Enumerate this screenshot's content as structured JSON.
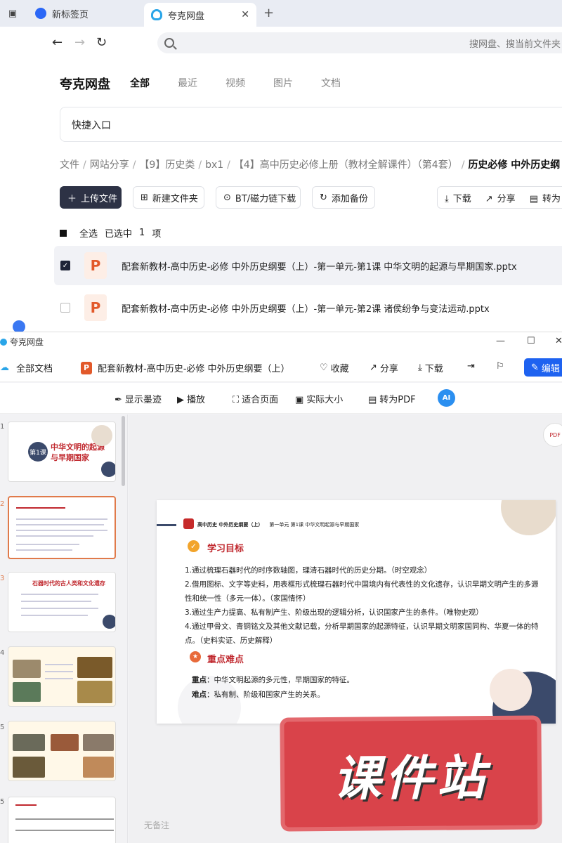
{
  "browser": {
    "tabs": [
      {
        "label": "新标签页"
      },
      {
        "label": "夸克网盘"
      }
    ],
    "address_placeholder": "搜网盘、搜当前文件夹"
  },
  "cloud": {
    "brand": "夸克网盘",
    "categories": [
      "全部",
      "最近",
      "视频",
      "图片",
      "文档"
    ],
    "quick_entry": "快捷入口",
    "breadcrumb": [
      "文件",
      "网站分享",
      "【9】历史类",
      "bx1",
      "【4】高中历史必修上册（教材全解课件）（第4套）",
      "历史必修 中外历史纲"
    ],
    "actions": {
      "upload": "上传文件",
      "new_folder": "新建文件夹",
      "bt": "BT/磁力链下载",
      "backup": "添加备份",
      "download": "下载",
      "share": "分享",
      "convert": "转为"
    },
    "selection": {
      "select_all": "全选",
      "selected": "已选中",
      "count": "1",
      "unit": "项"
    },
    "files": [
      {
        "name": "配套新教材-高中历史-必修  中外历史纲要（上）-第一单元-第1课  中华文明的起源与早期国家.pptx",
        "checked": true
      },
      {
        "name": "配套新教材-高中历史-必修  中外历史纲要（上）-第一单元-第2课  诸侯纷争与变法运动.pptx",
        "checked": false
      }
    ]
  },
  "viewer": {
    "window_title": "夸克网盘",
    "header": {
      "all_docs": "全部文档",
      "doc_title": "配套新教材-高中历史-必修 中外历史纲要（上）",
      "favorite": "收藏",
      "share": "分享",
      "download": "下载",
      "edit": "编辑"
    },
    "tools": {
      "show_ink": "显示墨迹",
      "play": "播放",
      "fit_page": "适合页面",
      "actual_size": "实际大小",
      "to_pdf": "转为PDF",
      "ai": "AI"
    },
    "thumbs": {
      "numbers": [
        "1",
        "2",
        "3",
        "4",
        "5",
        "5"
      ],
      "slide1_badge": "第1课",
      "slide1_title_1": "中华文明的起源",
      "slide1_title_2": "与早期国家",
      "slide3_title": "石器时代的古人类和文化遗存"
    },
    "slide": {
      "header_bold": "高中历史 中外历史纲要（上）",
      "header_rest": "第一单元 第1课 中华文明起源与早期国家",
      "h_goals": "学习目标",
      "goals": [
        "1.通过梳理石器时代的时序数轴图，理清石器时代的历史分期。（时空观念）",
        "2.借用图标、文字等史料，用表框形式梳理石器时代中国境内有代表性的文化遗存，认识早期文明产生的多源性和统一性（多元一体）。（家国情怀）",
        " 3.通过生产力提高、私有制产生、阶级出现的逻辑分析，认识国家产生的条件。（唯物史观）",
        "4.通过甲骨文、青铜铭文及其他文献记载，分析早期国家的起源特征，认识早期文明家国同构、华夏一体的特点。（史料实证、历史解释）"
      ],
      "h_key": "重点难点",
      "key_label": "重点",
      "key_text": "：中华文明起源的多元性，早期国家的特征。",
      "diff_label": "难点",
      "diff_text": "：私有制、阶级和国家产生的关系。"
    },
    "watermark": "课件站",
    "note": "无备注",
    "pdf_fab": "PDF"
  },
  "colors": {
    "accent_blue": "#1e62f0",
    "slide_red": "#c0282e",
    "watermark_red": "#d9434a"
  }
}
